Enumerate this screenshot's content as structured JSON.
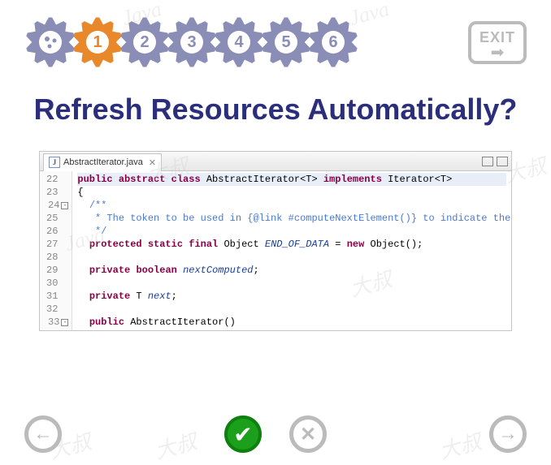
{
  "watermarks": [
    "Java",
    "Java",
    "大叔",
    "大叔",
    "Java",
    "大叔",
    "大叔",
    "大叔"
  ],
  "gears": [
    {
      "label": "",
      "active": false,
      "icon": true
    },
    {
      "label": "1",
      "active": true
    },
    {
      "label": "2",
      "active": false
    },
    {
      "label": "3",
      "active": false
    },
    {
      "label": "4",
      "active": false
    },
    {
      "label": "5",
      "active": false
    },
    {
      "label": "6",
      "active": false
    }
  ],
  "exit": {
    "label": "EXIT"
  },
  "title": "Refresh Resources Automatically?",
  "editor": {
    "tab_filename": "AbstractIterator.java",
    "tab_close": "✕",
    "lines": [
      {
        "n": 22,
        "html": "<span class='kw'>public</span> <span class='kw'>abstract</span> <span class='kw'>class</span> <span class='type'>AbstractIterator&lt;T&gt;</span> <span class='kw'>implements</span> <span class='type'>Iterator&lt;T&gt;</span>",
        "hl": true
      },
      {
        "n": 23,
        "html": "{"
      },
      {
        "n": 24,
        "html": "  <span class='comment'>/**</span>",
        "fold": "-"
      },
      {
        "n": 25,
        "html": "   <span class='comment'>* The token to be used in {<span class='link'>@link #computeNextElement()</span>} to indicate the</span>"
      },
      {
        "n": 26,
        "html": "   <span class='comment'>*/</span>"
      },
      {
        "n": 27,
        "html": "  <span class='kw'>protected</span> <span class='kw'>static</span> <span class='kw'>final</span> Object <span class='field'>END_OF_DATA</span> = <span class='kw'>new</span> Object();"
      },
      {
        "n": 28,
        "html": ""
      },
      {
        "n": 29,
        "html": "  <span class='kw'>private</span> <span class='kw'>boolean</span> <span class='field'>nextComputed</span>;"
      },
      {
        "n": 30,
        "html": ""
      },
      {
        "n": 31,
        "html": "  <span class='kw'>private</span> T <span class='field'>next</span>;"
      },
      {
        "n": 32,
        "html": ""
      },
      {
        "n": 33,
        "html": "  <span class='kw'>public</span> AbstractIterator()",
        "fold": "-"
      }
    ]
  },
  "nav": {
    "back": "←",
    "accept": "✔",
    "reject": "✕",
    "forward": "→"
  }
}
